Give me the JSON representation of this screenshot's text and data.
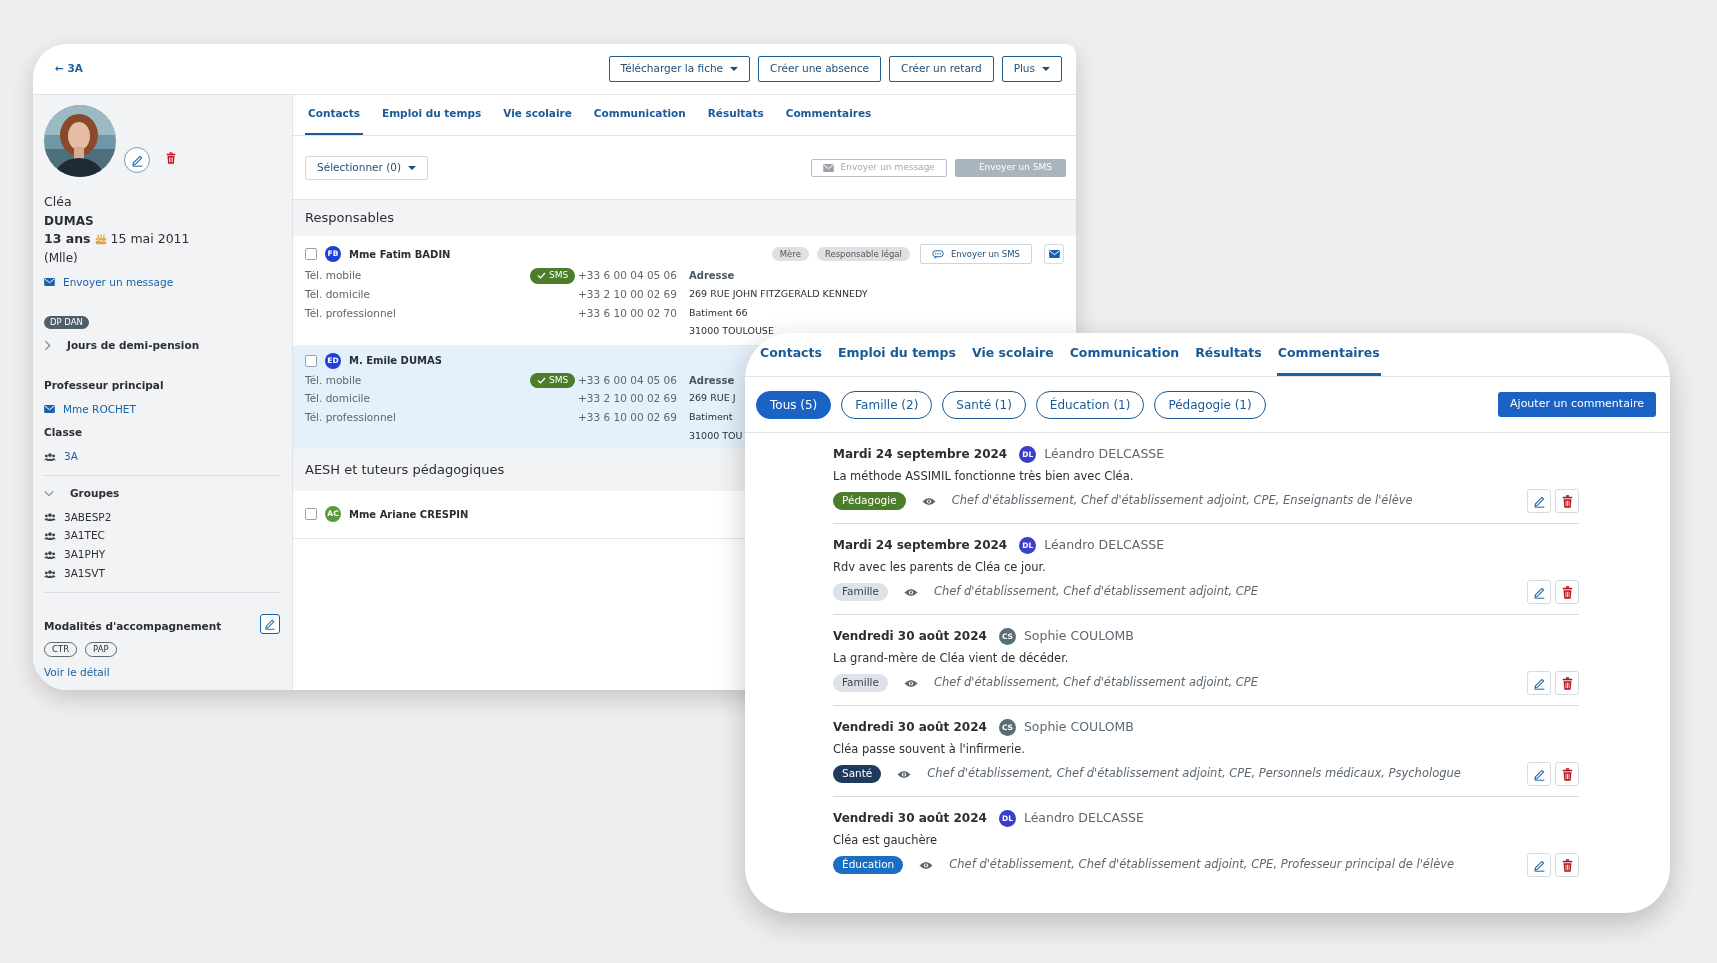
{
  "back_window": {
    "back_link": {
      "arrow": "←",
      "label": "3A"
    },
    "header_buttons": [
      {
        "label": "Télécharger la fiche",
        "dropdown": true
      },
      {
        "label": "Créer une absence",
        "dropdown": false
      },
      {
        "label": "Créer un retard",
        "dropdown": false
      },
      {
        "label": "Plus",
        "dropdown": true
      }
    ],
    "student": {
      "first_name": "Cléa",
      "last_name": "DUMAS",
      "age": "13 ans",
      "birthdate": "15 mai 2011",
      "civility": "(Mlle)",
      "message_link": "Envoyer un message",
      "regime_badge": "DP DAN"
    },
    "half_board": {
      "label": "Jours de demi-pension",
      "expanded": false
    },
    "main_teacher": {
      "heading": "Professeur principal",
      "name": "Mme ROCHET"
    },
    "class": {
      "heading": "Classe",
      "name": "3A"
    },
    "groups": {
      "heading": "Groupes",
      "expanded": true,
      "items": [
        "3ABESP2",
        "3A1TEC",
        "3A1PHY",
        "3A1SVT"
      ]
    },
    "support": {
      "heading": "Modalités d'accompagnement",
      "tags": [
        "CTR",
        "PAP"
      ],
      "link": "Voir le détail"
    },
    "tabs": [
      {
        "label": "Contacts",
        "selected": true
      },
      {
        "label": "Emploi du temps",
        "selected": false
      },
      {
        "label": "Vie scolaire",
        "selected": false
      },
      {
        "label": "Communication",
        "selected": false
      },
      {
        "label": "Résultats",
        "selected": false
      },
      {
        "label": "Commentaires",
        "selected": false
      }
    ],
    "toolbar": {
      "select": "Sélectionner (0)",
      "message_button": {
        "label": "Envoyer un message",
        "disabled": true
      },
      "sms_button": {
        "label": "Envoyer un SMS",
        "disabled": true
      }
    },
    "sections": [
      {
        "title": "Responsables",
        "contacts": [
          {
            "initials": "FB",
            "color": "#1f3fd6",
            "name": "Mme Fatim BADIN",
            "checked": false,
            "highlighted": false,
            "roles": [
              "Mère",
              "Responsable légal"
            ],
            "sms_action": "Envoyer un SMS",
            "phones": [
              {
                "label": "Tél. mobile",
                "number": "+33 6 00 04 05 06",
                "sms_badge": "SMS"
              },
              {
                "label": "Tél. domicile",
                "number": "+33 2 10 00 02 69"
              },
              {
                "label": "Tél. professionnel",
                "number": "+33 6 10 00 02 70"
              }
            ],
            "address": {
              "heading": "Adresse",
              "lines": [
                "269 RUE JOHN FITZGERALD KENNEDY",
                "Batiment 66",
                "31000 TOULOUSE"
              ]
            }
          },
          {
            "initials": "ED",
            "color": "#1f3fd6",
            "name": "M. Emile DUMAS",
            "checked": false,
            "highlighted": true,
            "phones": [
              {
                "label": "Tél. mobile",
                "number": "+33 6 00 04 05 06",
                "sms_badge": "SMS"
              },
              {
                "label": "Tél. domicile",
                "number": "+33 2 10 00 02 69"
              },
              {
                "label": "Tél. professionnel",
                "number": "+33 6 10 00 02 69"
              }
            ],
            "address": {
              "heading": "Adresse",
              "lines": [
                "269 RUE J",
                "Batiment",
                "31000 TOU"
              ]
            }
          }
        ]
      },
      {
        "title": "AESH et tuteurs pédagogiques",
        "contacts": [
          {
            "initials": "AC",
            "color": "#5b9a3c",
            "name": "Mme Ariane CRESPIN",
            "checked": false,
            "highlighted": false
          }
        ]
      }
    ]
  },
  "comments_panel": {
    "tabs": [
      {
        "label": "Contacts",
        "selected": false
      },
      {
        "label": "Emploi du temps",
        "selected": false
      },
      {
        "label": "Vie scolaire",
        "selected": false
      },
      {
        "label": "Communication",
        "selected": false
      },
      {
        "label": "Résultats",
        "selected": false
      },
      {
        "label": "Commentaires",
        "selected": true
      }
    ],
    "filters": [
      {
        "label": "Tous (5)",
        "selected": true
      },
      {
        "label": "Famille (2)",
        "selected": false
      },
      {
        "label": "Santé (1)",
        "selected": false
      },
      {
        "label": "Éducation (1)",
        "selected": false
      },
      {
        "label": "Pédagogie (1)",
        "selected": false
      }
    ],
    "add_button": "Ajouter un commentaire",
    "comments": [
      {
        "date": "Mardi 24 septembre 2024",
        "author": {
          "initials": "DL",
          "name": "Léandro DELCASSE",
          "color": "#3a3fc8"
        },
        "text": "La méthode ASSIMIL fonctionne très bien avec Cléa.",
        "category": {
          "label": "Pédagogie",
          "color": "#4b7d2b"
        },
        "visibility": "Chef d'établissement, Chef d'établissement adjoint, CPE, Enseignants de l'élève"
      },
      {
        "date": "Mardi 24 septembre 2024",
        "author": {
          "initials": "DL",
          "name": "Léandro DELCASSE",
          "color": "#3a3fc8"
        },
        "text": "Rdv avec les parents de Cléa ce jour.",
        "category": {
          "label": "Famille",
          "color": "#dde2e8"
        },
        "visibility": "Chef d'établissement, Chef d'établissement adjoint, CPE"
      },
      {
        "date": "Vendredi 30 août 2024",
        "author": {
          "initials": "CS",
          "name": "Sophie COULOMB",
          "color": "#5b6d79"
        },
        "text": "La grand-mère de Cléa vient de décéder.",
        "category": {
          "label": "Famille",
          "color": "#dde2e8"
        },
        "visibility": "Chef d'établissement, Chef d'établissement adjoint, CPE"
      },
      {
        "date": "Vendredi 30 août 2024",
        "author": {
          "initials": "CS",
          "name": "Sophie COULOMB",
          "color": "#5b6d79"
        },
        "text": "Cléa passe souvent à l'infirmerie.",
        "category": {
          "label": "Santé",
          "color": "#1e3a5f"
        },
        "visibility": "Chef d'établissement, Chef d'établissement adjoint, CPE, Personnels médicaux, Psychologue"
      },
      {
        "date": "Vendredi 30 août 2024",
        "author": {
          "initials": "DL",
          "name": "Léandro DELCASSE",
          "color": "#3a3fc8"
        },
        "text": "Cléa est gauchère",
        "category": {
          "label": "Éducation",
          "color": "#1a6fc4"
        },
        "visibility": "Chef d'établissement, Chef d'établissement adjoint, CPE, Professeur principal de l'élève"
      }
    ]
  }
}
